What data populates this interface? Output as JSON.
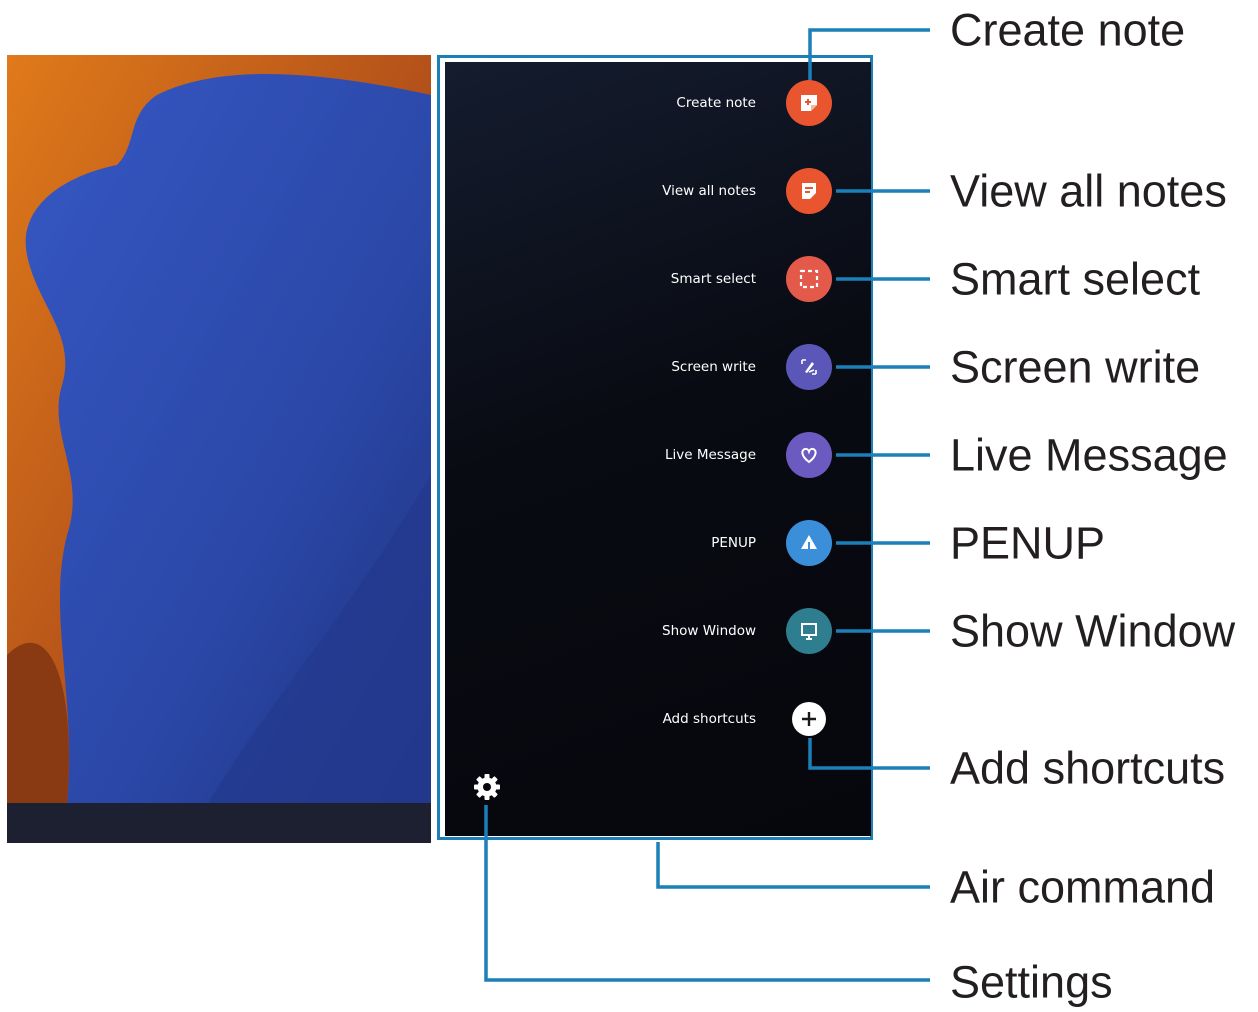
{
  "panel": {
    "items": [
      {
        "label": "Create note",
        "icon": "create-note-icon",
        "color": "#e8552f"
      },
      {
        "label": "View all notes",
        "icon": "view-all-notes-icon",
        "color": "#e8552f"
      },
      {
        "label": "Smart select",
        "icon": "smart-select-icon",
        "color": "#e35a4b"
      },
      {
        "label": "Screen write",
        "icon": "screen-write-icon",
        "color": "#5b57b8"
      },
      {
        "label": "Live Message",
        "icon": "live-message-icon",
        "color": "#6b5bc0"
      },
      {
        "label": "PENUP",
        "icon": "penup-icon",
        "color": "#3b8fd8"
      },
      {
        "label": "Show Window",
        "icon": "show-window-icon",
        "color": "#2f7e8f"
      },
      {
        "label": "Add shortcuts",
        "icon": "add-icon",
        "color": "#ffffff"
      }
    ],
    "settings_icon": "gear-icon"
  },
  "callouts": [
    "Create note",
    "View all notes",
    "Smart select",
    "Screen write",
    "Live Message",
    "PENUP",
    "Show Window",
    "Add shortcuts",
    "Air command",
    "Settings"
  ],
  "colors": {
    "callout_line": "#1b7fb8",
    "wallpaper_orange": "#c9661b",
    "wallpaper_blue": "#2e4fb8"
  }
}
